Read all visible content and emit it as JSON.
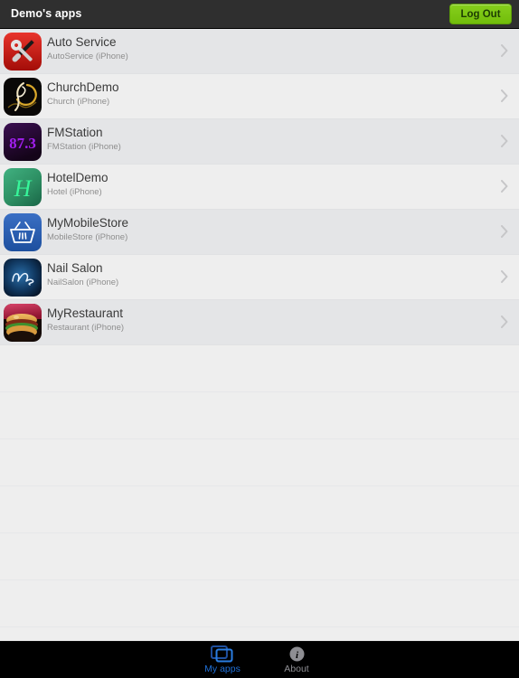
{
  "header": {
    "title": "Demo's apps",
    "logout_label": "Log Out",
    "bg_color": "#2f2f2f",
    "logout_color": "#76c511"
  },
  "list": {
    "apps": [
      {
        "name": "Auto Service",
        "subtitle": "AutoService (iPhone)",
        "icon": "auto-service-icon"
      },
      {
        "name": "ChurchDemo",
        "subtitle": "Church (iPhone)",
        "icon": "church-icon"
      },
      {
        "name": "FMStation",
        "subtitle": "FMStation (iPhone)",
        "icon": "fmstation-icon",
        "icon_text": "87.3"
      },
      {
        "name": "HotelDemo",
        "subtitle": "Hotel (iPhone)",
        "icon": "hotel-icon"
      },
      {
        "name": "MyMobileStore",
        "subtitle": "MobileStore (iPhone)",
        "icon": "mobilestore-icon"
      },
      {
        "name": "Nail Salon",
        "subtitle": "NailSalon (iPhone)",
        "icon": "nailsalon-icon"
      },
      {
        "name": "MyRestaurant",
        "subtitle": "Restaurant (iPhone)",
        "icon": "restaurant-icon"
      }
    ],
    "empty_row_count": 6,
    "row_bg_odd": "#e4e5e7",
    "row_bg_even": "#eeeeee",
    "disclosure_icon": "chevron-right-icon"
  },
  "tabbar": {
    "tabs": [
      {
        "label": "My apps",
        "icon": "screens-icon",
        "active": true,
        "color": "#1f6fd6"
      },
      {
        "label": "About",
        "icon": "info-circle-icon",
        "active": false,
        "color": "#8e8e93"
      }
    ],
    "bg_color": "#000000"
  }
}
